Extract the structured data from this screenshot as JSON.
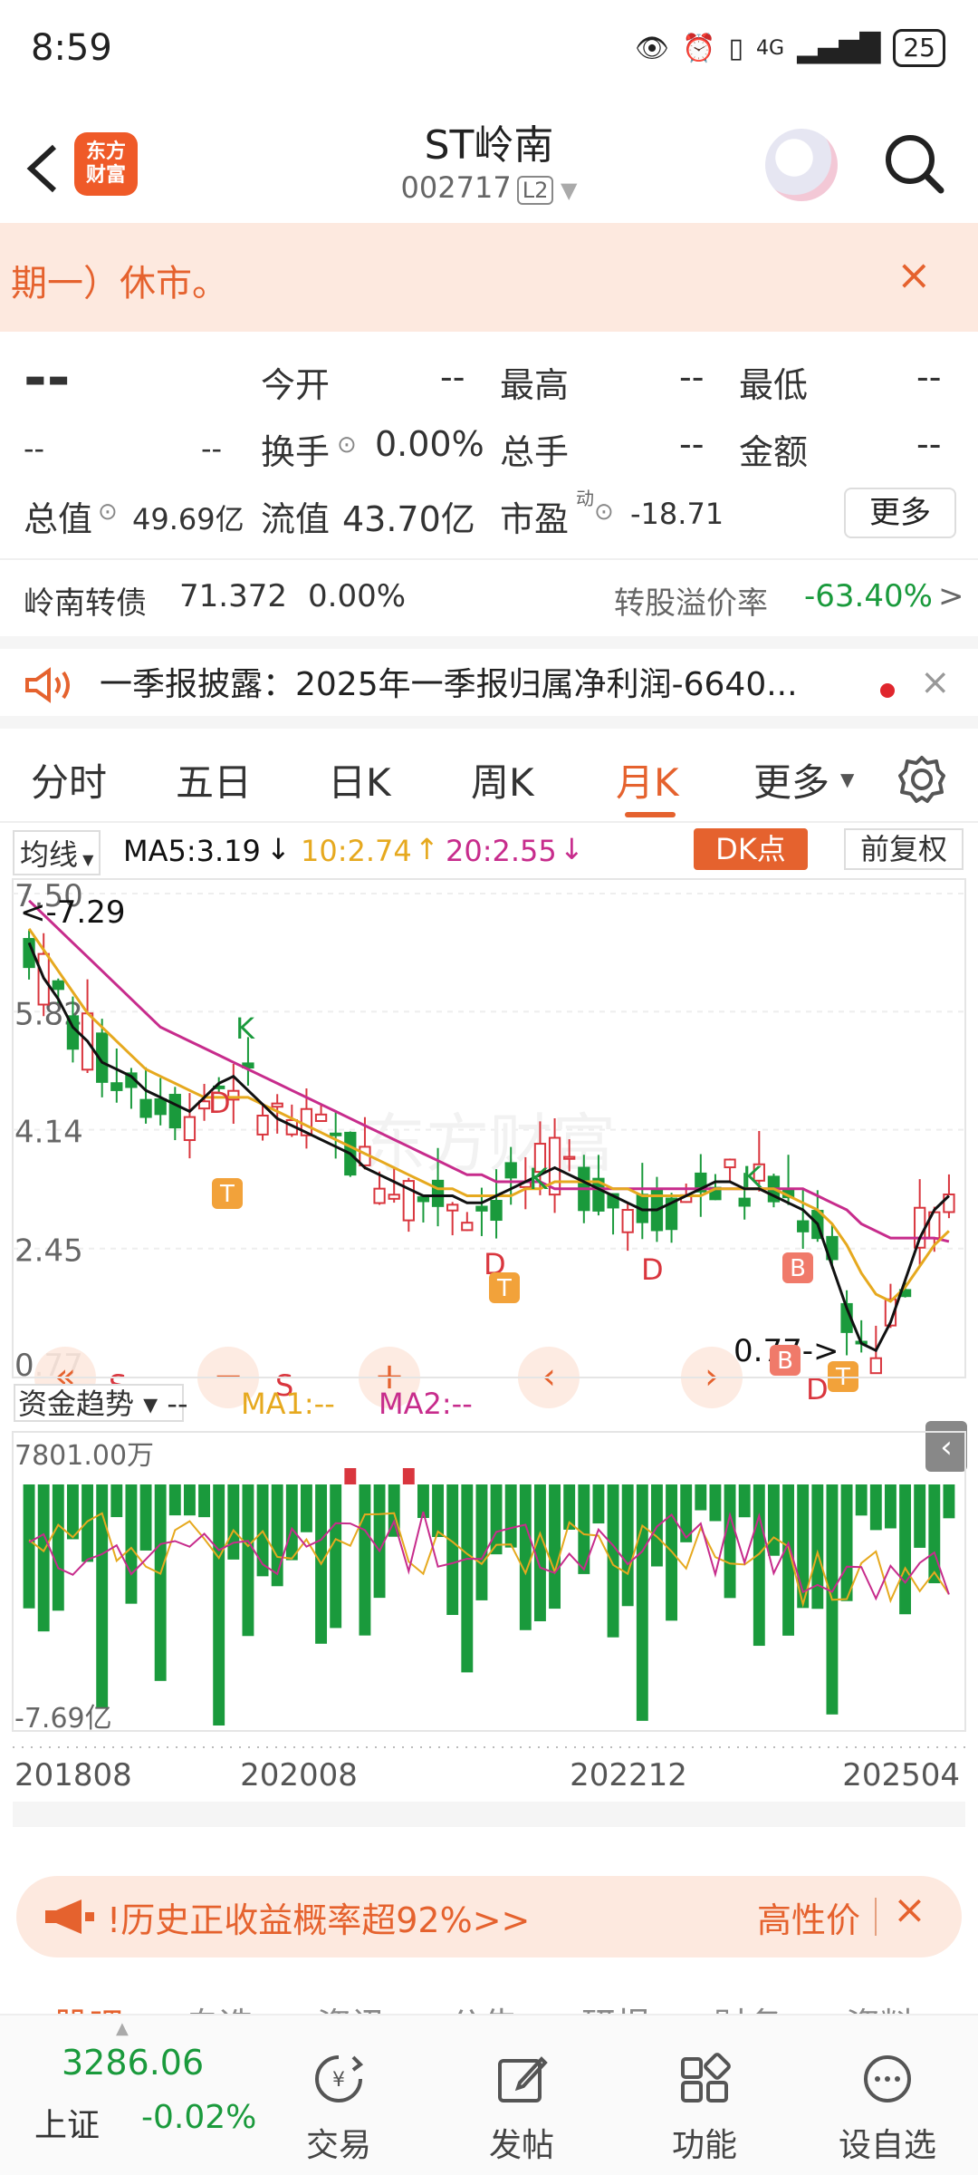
{
  "status_bar": {
    "time": "8:59",
    "network": "4G",
    "battery": "25"
  },
  "header": {
    "back_icon": "back-arrow-icon",
    "logo_text": "东方\n财富",
    "name": "ST岭南",
    "code": "002717",
    "level": "L2"
  },
  "notice": {
    "text": "期一）休市。",
    "close": "×"
  },
  "quote": {
    "price": "--",
    "change": "--",
    "change_pct": "--",
    "open_label": "今开",
    "open": "--",
    "high_label": "最高",
    "high": "--",
    "low_label": "最低",
    "low": "--",
    "turnover_label": "换手",
    "turnover": "0.00%",
    "volume_label": "总手",
    "volume": "--",
    "amount_label": "金额",
    "amount": "--",
    "mcap_label": "总值",
    "mcap": "49.69亿",
    "float_label": "流值",
    "float": "43.70亿",
    "pe_label": "市盈",
    "pe_super": "动",
    "pe": "-18.71",
    "more": "更多"
  },
  "bond": {
    "name": "岭南转债",
    "price": "71.372",
    "change": "0.00%",
    "premium_label": "转股溢价率",
    "premium": "-63.40%",
    "arrow": ">"
  },
  "news": {
    "text": "一季报披露：2025年一季报归属净利润-6640...",
    "close": "×"
  },
  "tabs": [
    "分时",
    "五日",
    "日K",
    "周K",
    "月K",
    "更多"
  ],
  "active_tab": "月K",
  "ma_bar": {
    "indicator": "均线",
    "ma5": "MA5:3.19",
    "ma10": "10:2.74",
    "ma20": "20:2.55",
    "dk": "DK点",
    "adjust": "前复权"
  },
  "chart_data": {
    "type": "candlestick",
    "price_axis": [
      "7.50",
      "5.82",
      "4.14",
      "2.45",
      "0.77"
    ],
    "high_marker": "<-7.29",
    "low_marker": "0.77->",
    "x_labels": [
      "201808",
      "202008",
      "202212",
      "202504"
    ],
    "ma5": [
      6.8,
      6.3,
      6.0,
      5.6,
      5.4,
      5.1,
      5.0,
      4.9,
      4.7,
      4.6,
      4.5,
      4.4,
      4.6,
      4.8,
      4.9,
      4.7,
      4.5,
      4.3,
      4.2,
      4.1,
      4.0,
      3.9,
      3.8,
      3.6,
      3.5,
      3.4,
      3.3,
      3.2,
      3.2,
      3.2,
      3.1,
      3.1,
      3.2,
      3.3,
      3.4,
      3.5,
      3.6,
      3.5,
      3.4,
      3.3,
      3.2,
      3.1,
      3.0,
      3.0,
      3.1,
      3.2,
      3.3,
      3.4,
      3.4,
      3.3,
      3.3,
      3.2,
      3.1,
      3.0,
      2.8,
      2.2,
      1.6,
      1.1,
      1.0,
      1.4,
      2.0,
      2.6,
      3.0,
      3.2
    ],
    "ma10": [
      7.0,
      6.7,
      6.4,
      6.1,
      5.8,
      5.6,
      5.4,
      5.2,
      5.0,
      4.9,
      4.8,
      4.7,
      4.6,
      4.6,
      4.6,
      4.6,
      4.5,
      4.4,
      4.3,
      4.2,
      4.1,
      4.0,
      3.9,
      3.8,
      3.7,
      3.6,
      3.5,
      3.4,
      3.3,
      3.3,
      3.2,
      3.2,
      3.2,
      3.2,
      3.3,
      3.3,
      3.4,
      3.4,
      3.4,
      3.4,
      3.3,
      3.3,
      3.2,
      3.2,
      3.2,
      3.2,
      3.2,
      3.3,
      3.3,
      3.3,
      3.3,
      3.3,
      3.2,
      3.1,
      3.0,
      2.8,
      2.5,
      2.1,
      1.8,
      1.7,
      1.9,
      2.2,
      2.5,
      2.7
    ],
    "ma20": [
      7.4,
      7.2,
      7.0,
      6.8,
      6.6,
      6.4,
      6.2,
      6.0,
      5.8,
      5.6,
      5.5,
      5.4,
      5.3,
      5.2,
      5.1,
      5.0,
      4.9,
      4.8,
      4.7,
      4.6,
      4.5,
      4.4,
      4.3,
      4.2,
      4.1,
      4.0,
      3.9,
      3.8,
      3.7,
      3.6,
      3.5,
      3.5,
      3.4,
      3.4,
      3.4,
      3.4,
      3.3,
      3.3,
      3.3,
      3.3,
      3.3,
      3.3,
      3.3,
      3.3,
      3.3,
      3.3,
      3.3,
      3.3,
      3.3,
      3.3,
      3.3,
      3.3,
      3.3,
      3.3,
      3.2,
      3.1,
      3.0,
      2.8,
      2.7,
      2.6,
      2.6,
      2.6,
      2.6,
      2.55
    ],
    "signals": [
      "K",
      "D",
      "T",
      "K",
      "D",
      "T",
      "K",
      "D",
      "B",
      "B",
      "D",
      "T",
      "S",
      "S"
    ],
    "fund_indicator": {
      "name": "资金趋势",
      "ma1": "MA1:--",
      "ma2": "MA2:--",
      "top": "7801.00万",
      "bottom": "-7.69亿"
    }
  },
  "chart_controls": {
    "prev_fast": "«",
    "zoom_out": "−",
    "zoom_in": "+",
    "prev": "‹",
    "next": "›"
  },
  "bottom_banner": {
    "text": "!历史正收益概率超92%>>",
    "tag": "高性价",
    "close": "×"
  },
  "hidden_tabs": [
    "股吧",
    "自选",
    "资讯",
    "公告",
    "研报",
    "财务",
    "资料"
  ],
  "nav": {
    "index_value": "3286.06",
    "index_name": "上证",
    "index_change": "-0.02%",
    "items": [
      "交易",
      "发帖",
      "功能",
      "设自选"
    ]
  },
  "colors": {
    "accent": "#e5622e",
    "up": "#d9363e",
    "down": "#1a9a3c",
    "ma5": "#111111",
    "ma10": "#e6a91f",
    "ma20": "#c72c8c"
  }
}
